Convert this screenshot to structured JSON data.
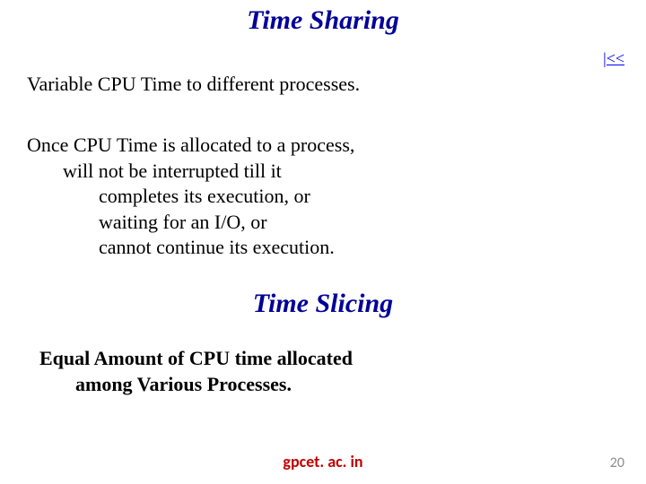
{
  "title1": "Time Sharing",
  "nav": "|<<",
  "line_variable": "Variable CPU Time to different processes.",
  "block": {
    "l1": "Once CPU Time is allocated to a process,",
    "l2": "will not be interrupted till it",
    "l3": "completes its execution, or",
    "l4": "waiting for an I/O, or",
    "l5": "cannot continue its execution."
  },
  "title2": "Time Slicing",
  "block2": {
    "l1": "Equal Amount of CPU time allocated",
    "l2": "among Various Processes."
  },
  "footer": {
    "center": "gpcet. ac. in",
    "page": "20"
  }
}
